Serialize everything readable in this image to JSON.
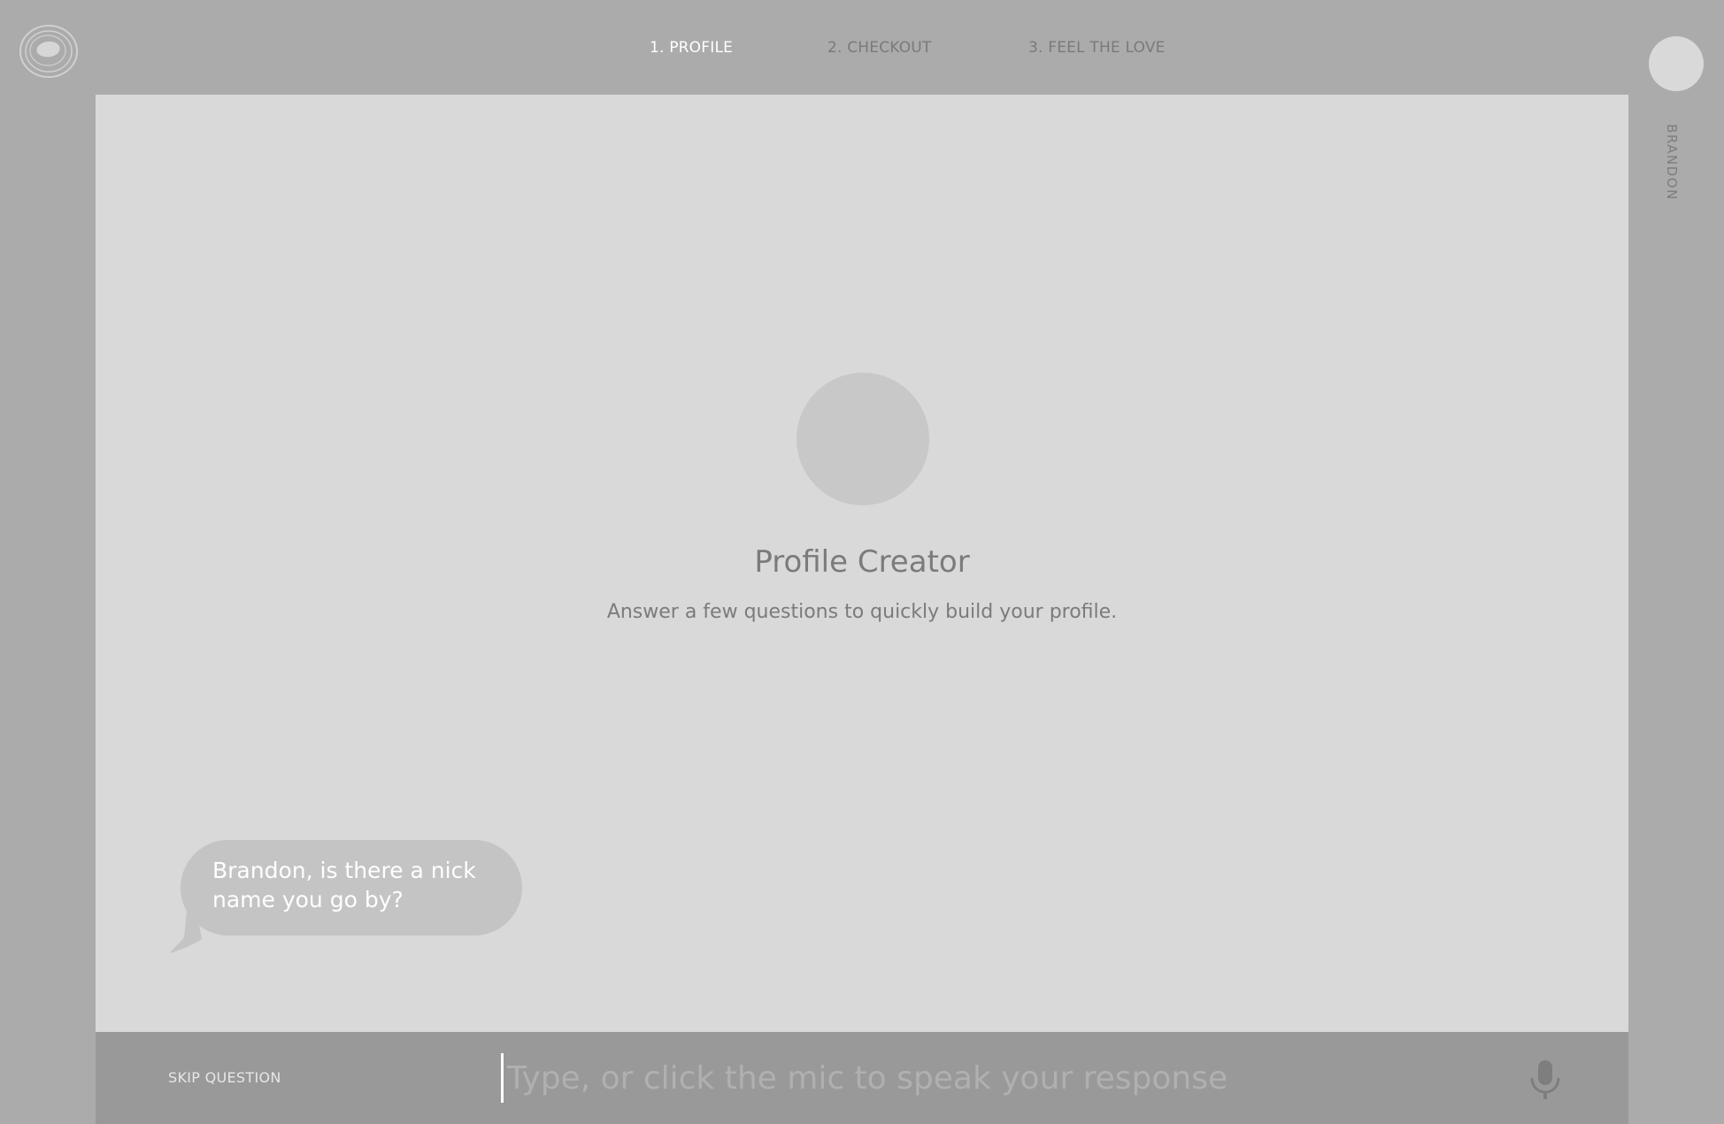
{
  "header": {
    "logo_icon": "agate-logo-icon",
    "steps": [
      {
        "label": "1. PROFILE",
        "active": true
      },
      {
        "label": "2. CHECKOUT",
        "active": false
      },
      {
        "label": "3. FEEL THE LOVE",
        "active": false
      }
    ],
    "user": {
      "name": "BRANDON",
      "avatar_icon": "user-avatar-icon"
    }
  },
  "main": {
    "avatar_icon": "profile-avatar-icon",
    "title": "Profile Creator",
    "subtitle": "Answer a few questions to quickly build your profile.",
    "bubble_text": "Brandon, is there a nick name you go by?"
  },
  "bottom": {
    "skip_label": "SKIP QUESTION",
    "input_value": "",
    "input_placeholder": "Type, or click the mic to speak your response",
    "mic_icon": "microphone-icon"
  },
  "colors": {
    "background": "#ababab",
    "panel": "#d9d9d9",
    "bottom_bar": "#999999",
    "text_muted": "#7b7b7b",
    "active_step": "#ffffff"
  }
}
